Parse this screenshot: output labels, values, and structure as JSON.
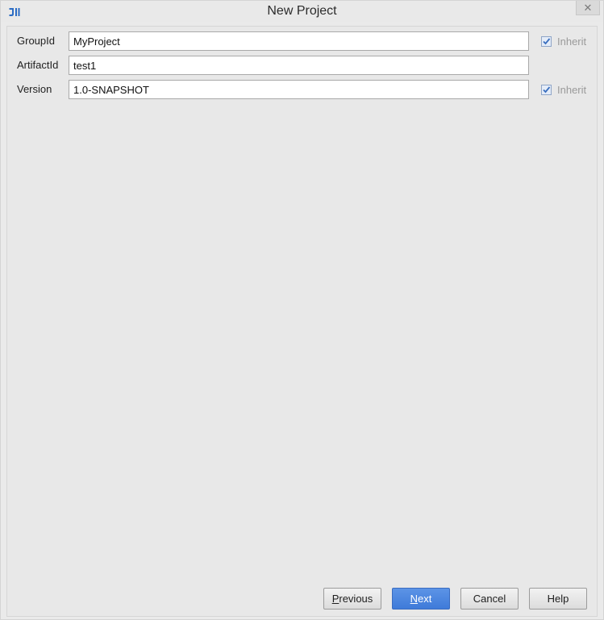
{
  "window": {
    "title": "New Project",
    "close_icon": "close-icon",
    "app_icon": "intellij-idea-icon"
  },
  "form": {
    "group_id": {
      "label": "GroupId",
      "value": "MyProject",
      "inherit_label": "Inherit",
      "inherit_checked": true
    },
    "artifact_id": {
      "label": "ArtifactId",
      "value": "test1"
    },
    "version": {
      "label": "Version",
      "value": "1.0-SNAPSHOT",
      "inherit_label": "Inherit",
      "inherit_checked": true
    }
  },
  "buttons": {
    "previous": {
      "mnemonic": "P",
      "rest": "revious"
    },
    "next": {
      "mnemonic": "N",
      "rest": "ext"
    },
    "cancel": "Cancel",
    "help": "Help"
  },
  "colors": {
    "primary_button": "#3f7bd9",
    "checkbox_check": "#3a6fbf",
    "app_icon": "#2b6cc4"
  }
}
